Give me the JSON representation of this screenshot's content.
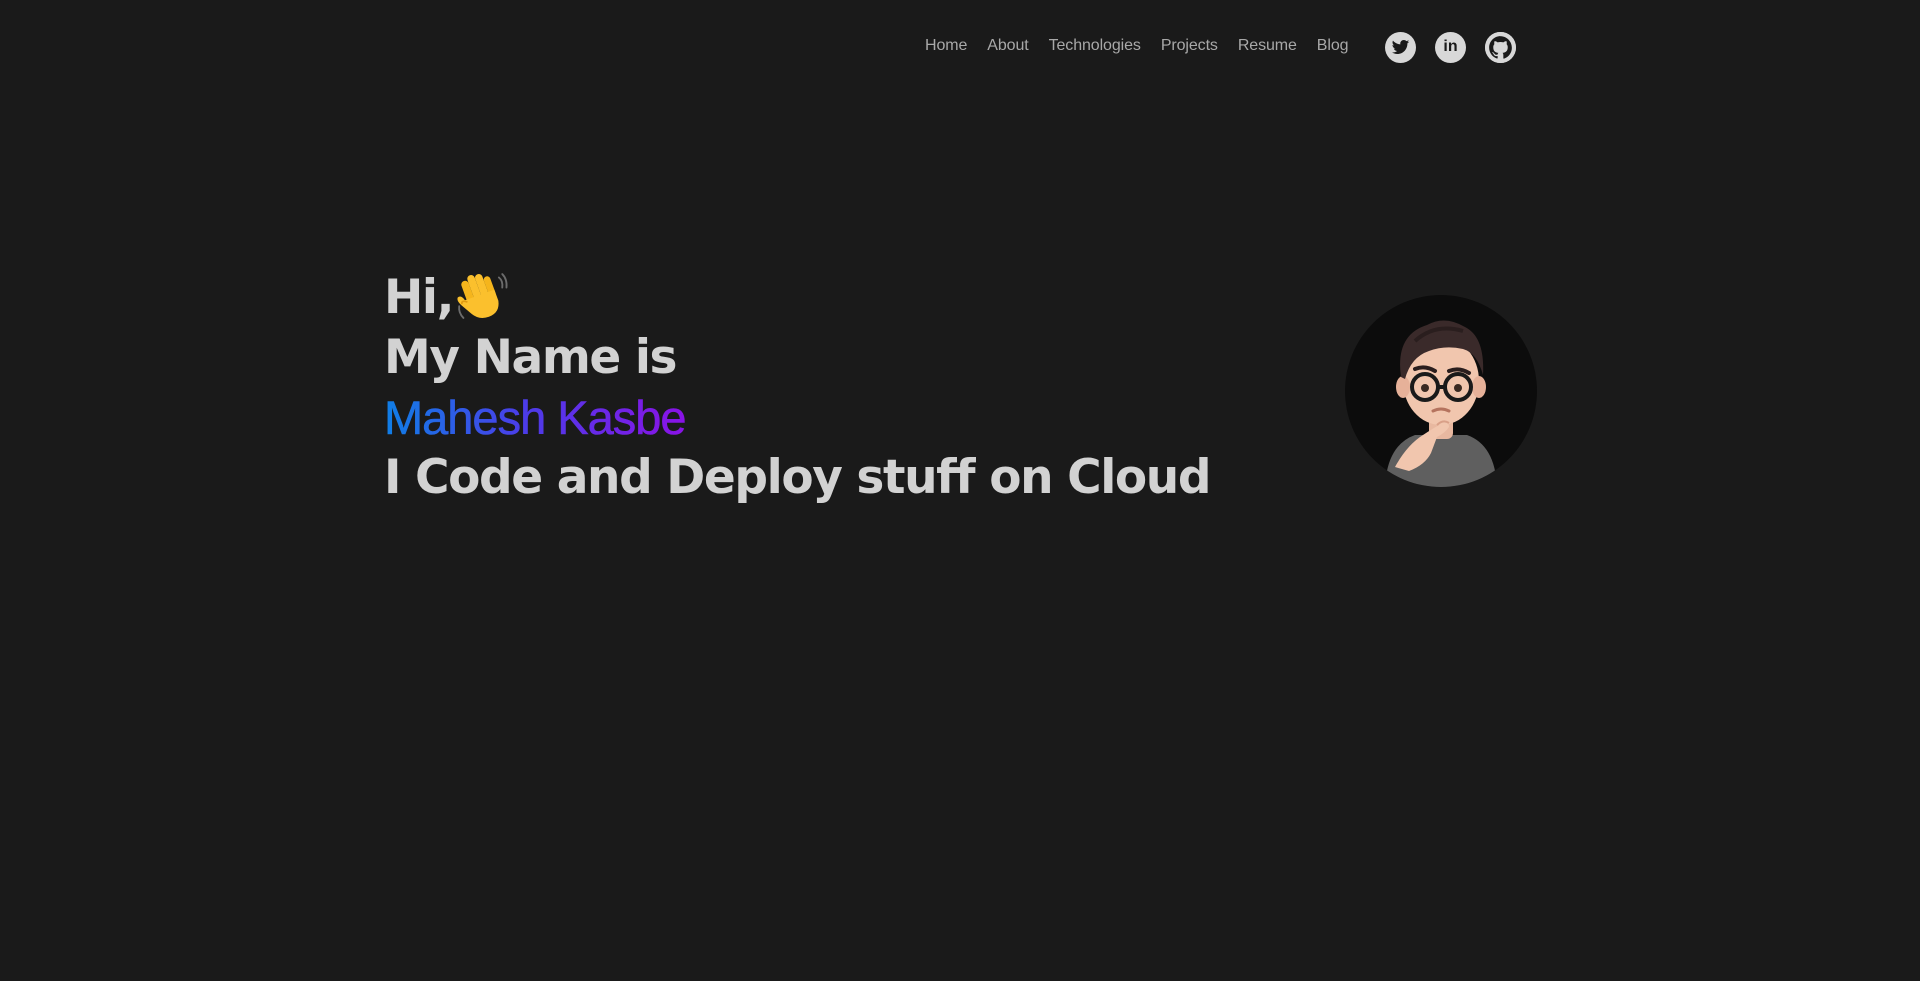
{
  "nav": {
    "links": [
      "Home",
      "About",
      "Technologies",
      "Projects",
      "Resume",
      "Blog"
    ]
  },
  "socials": [
    {
      "icon": "twitter-icon"
    },
    {
      "icon": "linkedin-icon",
      "glyph": "in"
    },
    {
      "icon": "github-icon"
    }
  ],
  "hero": {
    "greeting": "Hi,",
    "wave_icon": "waving-hand-icon",
    "intro": "My Name is",
    "name": "Mahesh Kasbe",
    "tagline": "I Code and Deploy stuff on Cloud"
  },
  "colors": {
    "background": "#1a1a1a",
    "text": "#d2d2d2",
    "nav_text": "#a8a8a8",
    "name_gradient_start": "#0f7fe6",
    "name_gradient_end": "#8a12e6",
    "social_bg": "#d8d8d8"
  }
}
